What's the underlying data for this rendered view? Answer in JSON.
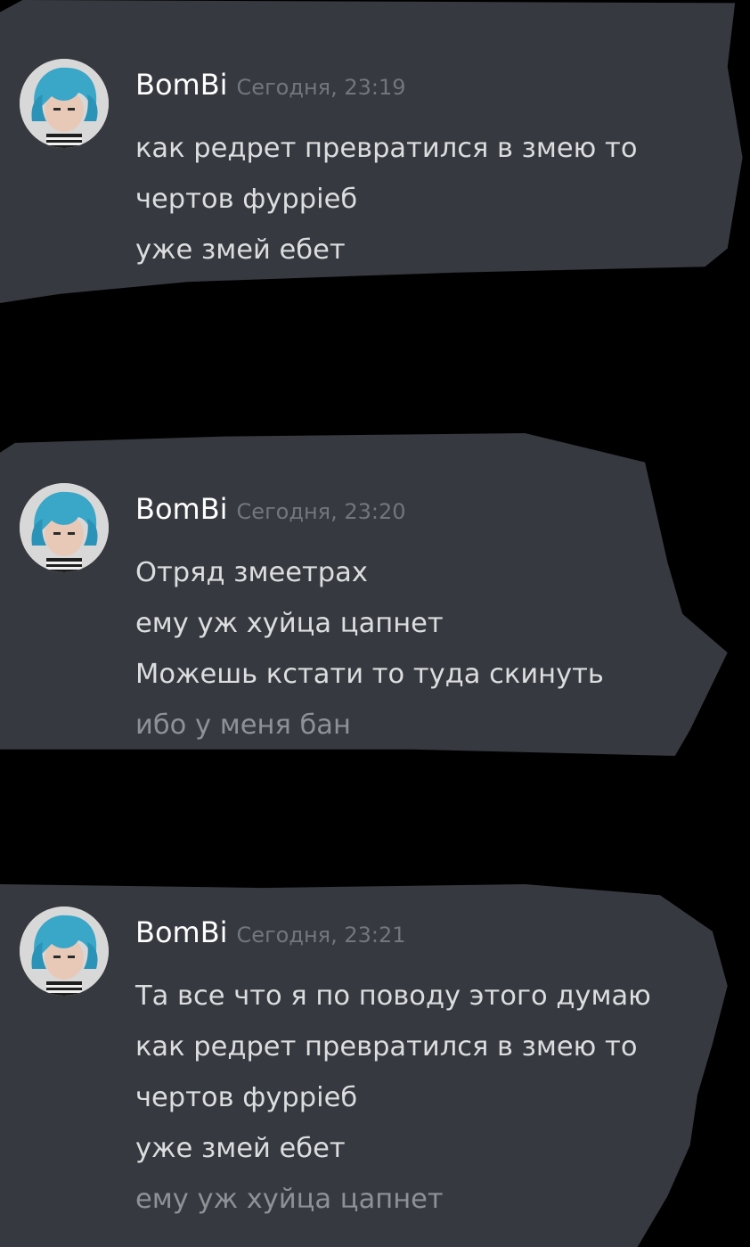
{
  "messages": [
    {
      "author": "BomBi",
      "timestamp": "Сегодня, 23:19",
      "avatar_icon": "user-avatar-blue-hair",
      "lines": [
        "как редрет превратился в змею то",
        "чертов фуррieб",
        "уже змей ебет"
      ]
    },
    {
      "author": "BomBi",
      "timestamp": "Сегодня, 23:20",
      "avatar_icon": "user-avatar-blue-hair",
      "lines": [
        "Отряд змеетрах",
        "ему уж хуйца цапнет",
        "Можешь кстати то туда скинуть",
        "ибо у меня бан"
      ]
    },
    {
      "author": "BomBi",
      "timestamp": "Сегодня, 23:21",
      "avatar_icon": "user-avatar-blue-hair",
      "lines": [
        "Та все что я по поводу этого думаю",
        "как редрет превратился в змею то",
        "чертов фуррieб",
        "уже змей ебет",
        "ему уж хуйца цапнет"
      ]
    }
  ],
  "colors": {
    "background": "#000000",
    "panel": "#36393f",
    "username": "#ffffff",
    "message_text": "#dcddde",
    "timestamp": "#72767d"
  }
}
